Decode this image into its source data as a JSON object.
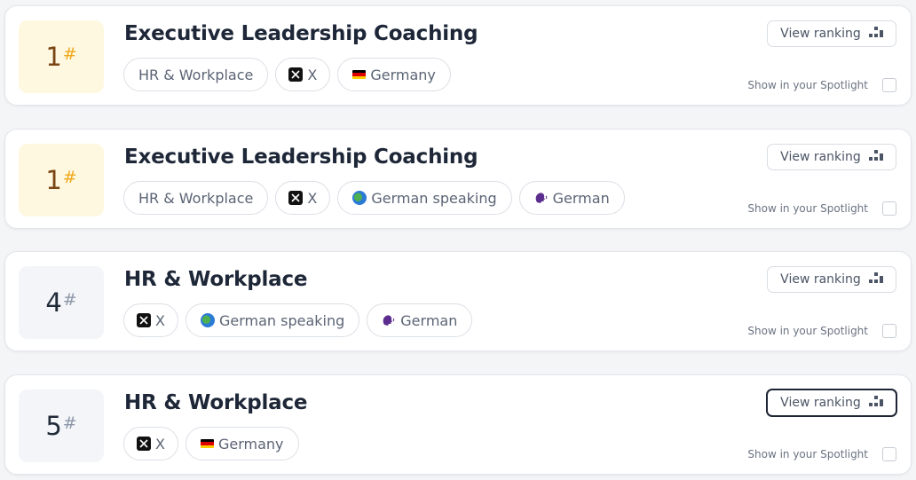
{
  "colors": {
    "gold_bg": "#fef8e1",
    "gold_hash": "#f0a81b",
    "gold_num": "#7a4513",
    "gray_bg": "#f3f5f8",
    "title": "#1e2738"
  },
  "cards": [
    {
      "rank": "1",
      "hash": "#",
      "title": "Executive Leadership Coaching",
      "view_label": "View ranking",
      "spotlight_label": "Show in your Spotlight",
      "chips": [
        "HR & Workplace",
        "X",
        "Germany"
      ]
    },
    {
      "rank": "1",
      "hash": "#",
      "title": "Executive Leadership Coaching",
      "view_label": "View ranking",
      "spotlight_label": "Show in your Spotlight",
      "chips": [
        "HR & Workplace",
        "X",
        "German speaking",
        "German"
      ]
    },
    {
      "rank": "4",
      "hash": "#",
      "title": "HR & Workplace",
      "view_label": "View ranking",
      "spotlight_label": "Show in your Spotlight",
      "chips": [
        "X",
        "German speaking",
        "German"
      ]
    },
    {
      "rank": "5",
      "hash": "#",
      "title": "HR & Workplace",
      "view_label": "View ranking",
      "spotlight_label": "Show in your Spotlight",
      "chips": [
        "X",
        "Germany"
      ]
    }
  ],
  "icons": {
    "x": "x-logo-icon",
    "germany": "germany-flag-icon",
    "globe": "globe-icon",
    "speaking": "speaking-head-icon",
    "ranking": "podium-icon"
  }
}
